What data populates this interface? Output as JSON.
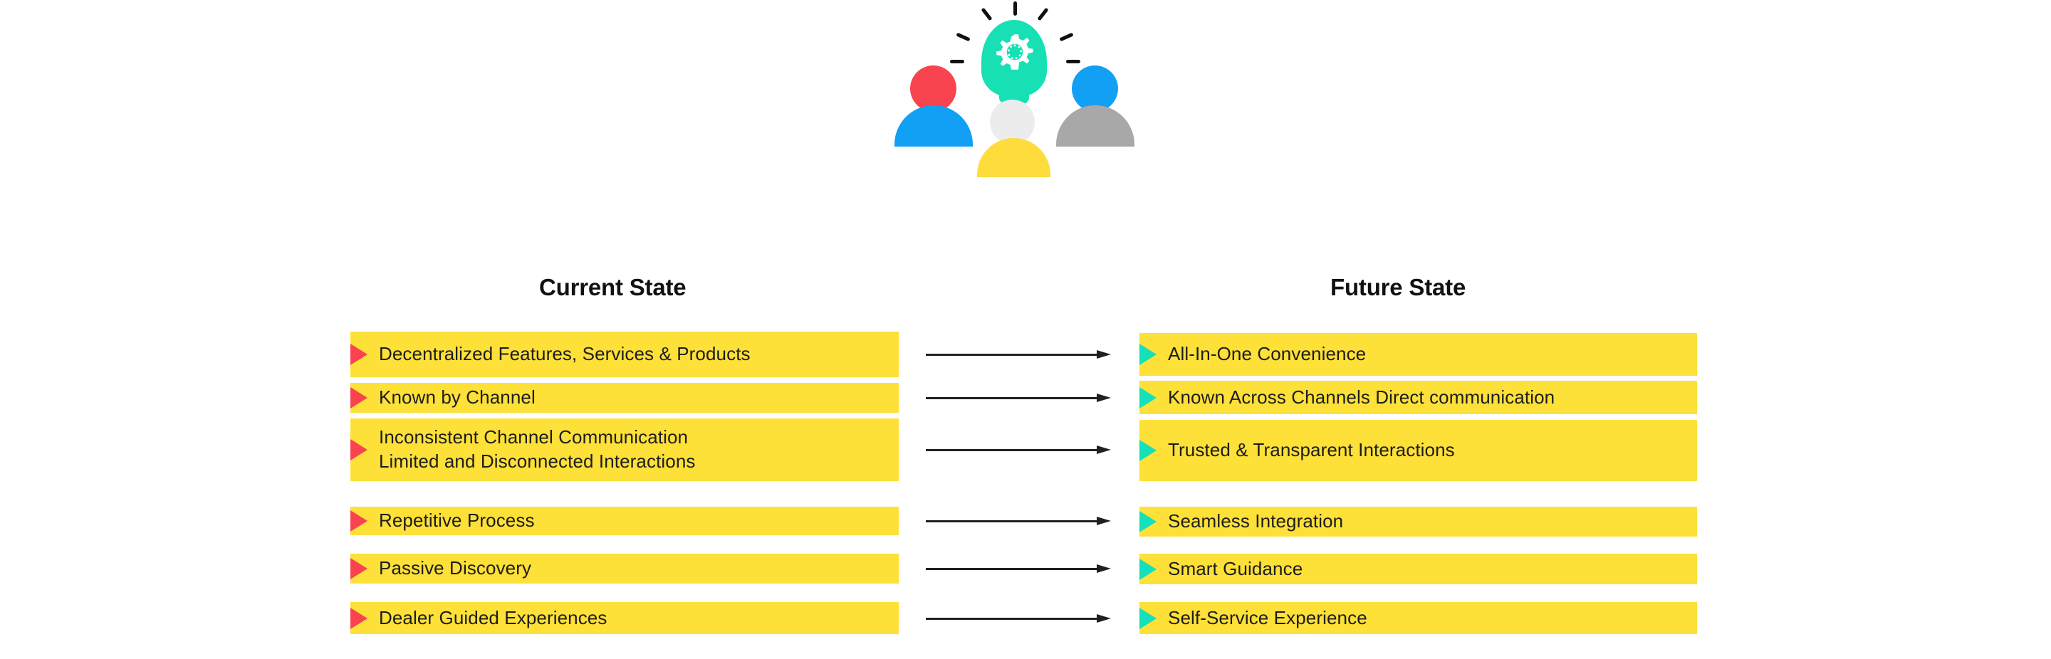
{
  "hero": {
    "bulb_icon": "lightbulb-gear-icon",
    "bulb_color": "#16e0b4",
    "gear_color": "#ffffff",
    "ray_color": "#111111",
    "people": [
      {
        "name": "person-left",
        "head_color": "#f9434f",
        "body_color": "#12a0f5"
      },
      {
        "name": "person-right",
        "head_color": "#12a0f5",
        "body_color": "#a8a8a8"
      },
      {
        "name": "person-center",
        "head_color": "#ececec",
        "body_color": "#fddc3c"
      }
    ]
  },
  "columns": {
    "current_heading": "Current State",
    "future_heading": "Future State"
  },
  "colors": {
    "bar": "#fde038",
    "current_marker": "#f9434f",
    "future_marker": "#15e0b9",
    "text": "#1d1d1b",
    "arrow": "#231f20"
  },
  "rows": [
    {
      "current": "Decentralized Features, Services & Products",
      "future": "All-In-One Convenience"
    },
    {
      "current": "Known by Channel",
      "future": "Known Across Channels Direct communication"
    },
    {
      "current": "Inconsistent Channel Communication\nLimited and Disconnected Interactions",
      "future": "Trusted & Transparent Interactions"
    },
    {
      "current": "Repetitive Process",
      "future": "Seamless Integration"
    },
    {
      "current": "Passive Discovery",
      "future": "Smart Guidance"
    },
    {
      "current": "Dealer Guided Experiences",
      "future": "Self-Service Experience"
    }
  ]
}
